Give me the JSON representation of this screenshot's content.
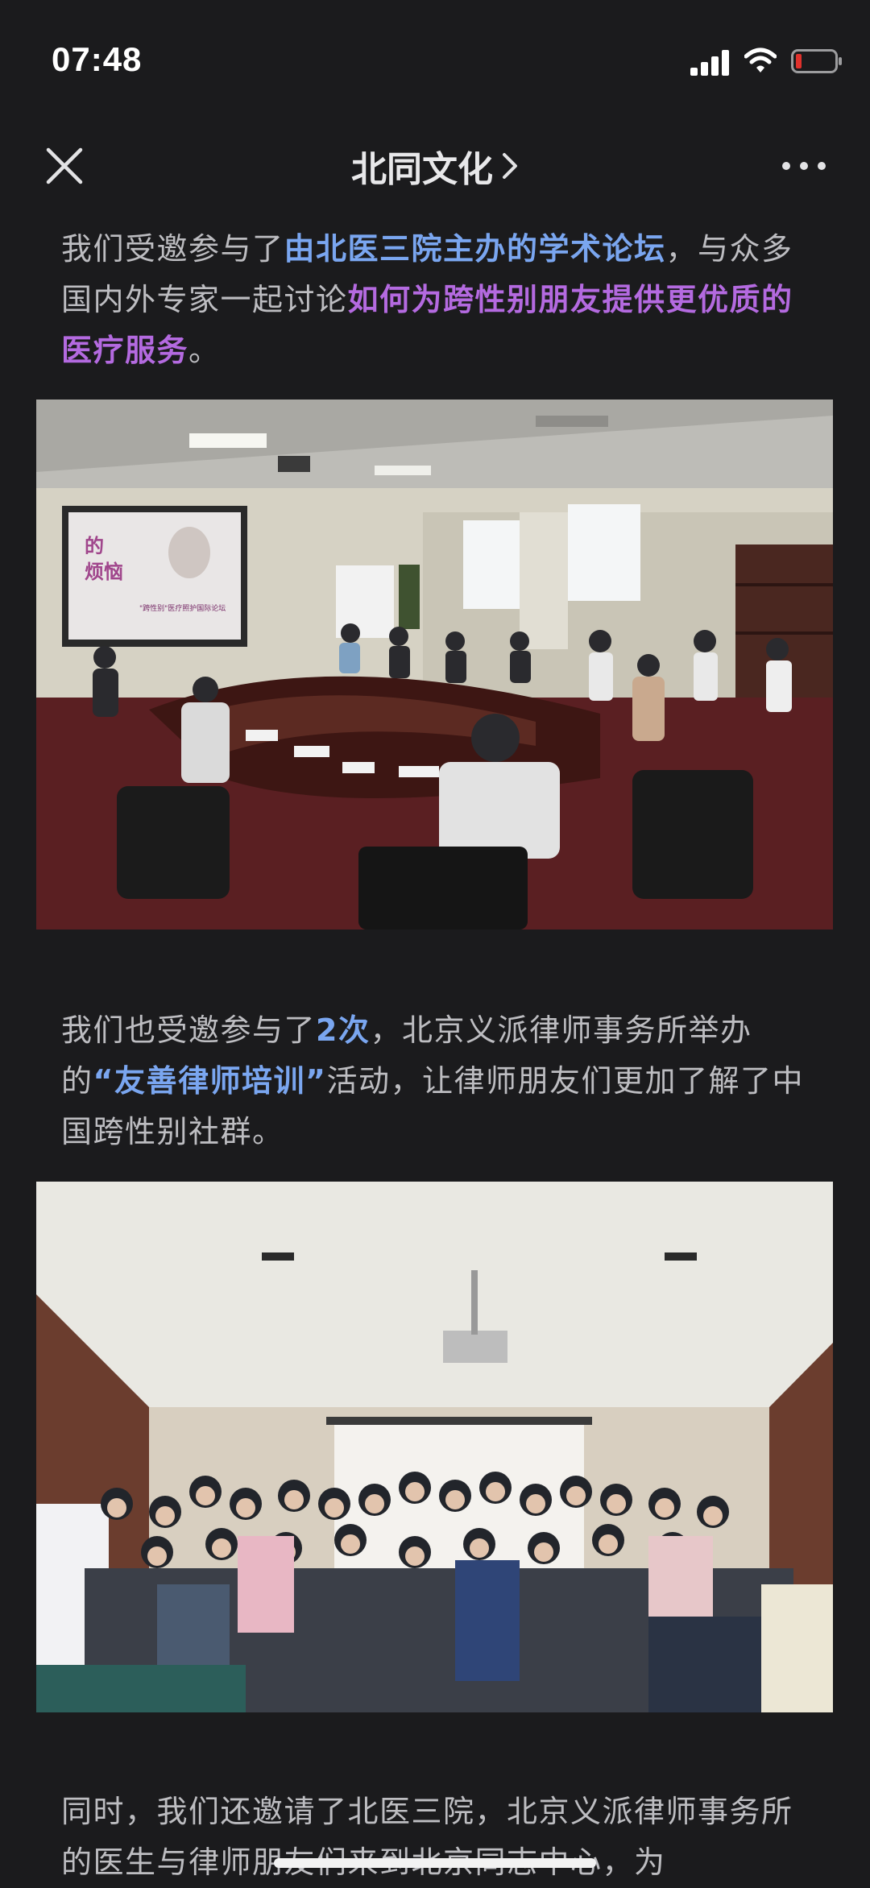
{
  "status_bar": {
    "time": "07:48"
  },
  "nav": {
    "title": "北同文化"
  },
  "paragraph1": {
    "t1": "我们受邀参与了",
    "h1": "由北医三院主办的学术论坛",
    "t2": "，与众多国内外专家一起讨论",
    "h2": "如何为跨性别朋友提供更优质的医疗服务",
    "t3": "。"
  },
  "photo1": {
    "slide_line1": "的",
    "slide_line2": "烦恼",
    "slide_caption": "\"跨性别\"医疗照护国际论坛"
  },
  "paragraph2": {
    "t1": "我们也受邀参与了",
    "h1": "2次",
    "t2": "，北京义派律师事务所举办的",
    "h2": "“友善律师培训”",
    "t3": "活动，让律师朋友们更加了解了中国跨性别社群。"
  },
  "paragraph3": {
    "t1": "同时，我们还邀请了北医三院，北京义派律师事务所的医生与律师朋友们来到北京同志中心，为"
  },
  "colors": {
    "background": "#1b1b1d",
    "text": "#bdbdc1",
    "highlight_blue": "#7aa6f0",
    "highlight_purple": "#b46ae0",
    "battery_low": "#e0312c"
  },
  "icons": [
    "close-icon",
    "chevron-right-icon",
    "more-icon",
    "signal-icon",
    "wifi-icon",
    "battery-icon"
  ]
}
